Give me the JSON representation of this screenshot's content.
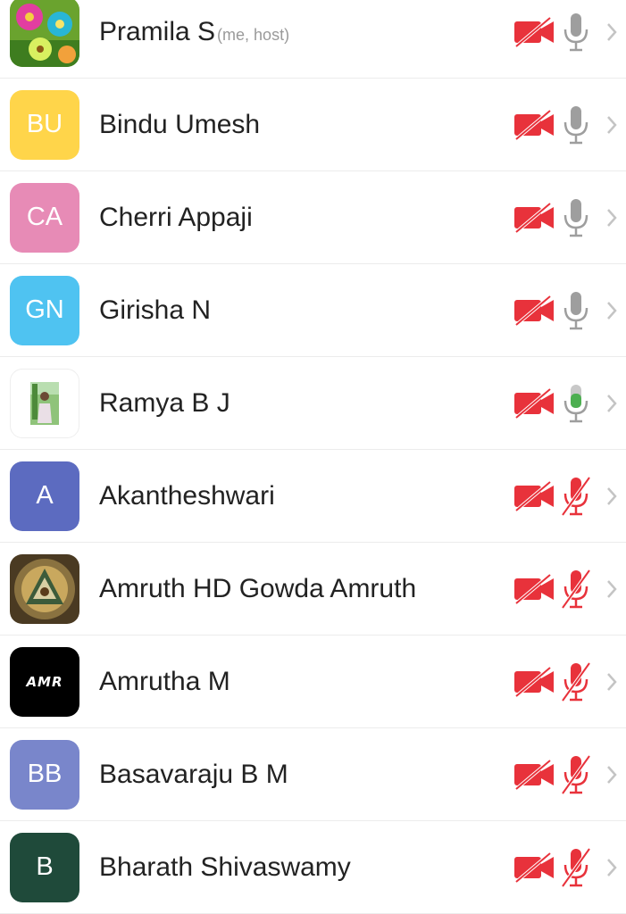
{
  "participants": [
    {
      "name": "Pramila S",
      "tag": "(me, host)",
      "avatar": {
        "type": "image",
        "icon": "flower-photo-avatar"
      },
      "video": "off",
      "audio": "on-idle"
    },
    {
      "name": "Bindu Umesh",
      "tag": "",
      "avatar": {
        "type": "initials",
        "initials": "BU",
        "color": "#FFD54A"
      },
      "video": "off",
      "audio": "on-idle"
    },
    {
      "name": "Cherri Appaji",
      "tag": "",
      "avatar": {
        "type": "initials",
        "initials": "CA",
        "color": "#E78BB6"
      },
      "video": "off",
      "audio": "on-idle"
    },
    {
      "name": "Girisha N",
      "tag": "",
      "avatar": {
        "type": "initials",
        "initials": "GN",
        "color": "#4FC3F1"
      },
      "video": "off",
      "audio": "on-idle"
    },
    {
      "name": "Ramya B J",
      "tag": "",
      "avatar": {
        "type": "image",
        "icon": "person-photo-avatar"
      },
      "video": "off",
      "audio": "speaking"
    },
    {
      "name": "Akantheshwari",
      "tag": "",
      "avatar": {
        "type": "initials",
        "initials": "A",
        "color": "#5C6BC0"
      },
      "video": "off",
      "audio": "muted"
    },
    {
      "name": "Amruth HD Gowda Amruth",
      "tag": "",
      "avatar": {
        "type": "image",
        "icon": "emblem-photo-avatar"
      },
      "video": "off",
      "audio": "muted"
    },
    {
      "name": "Amrutha M",
      "tag": "",
      "avatar": {
        "type": "image",
        "icon": "logo-avatar",
        "logo_text": "AMR"
      },
      "video": "off",
      "audio": "muted"
    },
    {
      "name": "Basavaraju B M",
      "tag": "",
      "avatar": {
        "type": "initials",
        "initials": "BB",
        "color": "#7986CB"
      },
      "video": "off",
      "audio": "muted"
    },
    {
      "name": "Bharath Shivaswamy",
      "tag": "",
      "avatar": {
        "type": "initials",
        "initials": "B",
        "color": "#1F4A3A"
      },
      "video": "off",
      "audio": "muted"
    }
  ],
  "colors": {
    "video_off": "#E8323B",
    "mic_idle": "#9E9E9E",
    "mic_speaking": "#4CAF50",
    "mic_muted": "#E8323B",
    "chevron": "#C4C4C4",
    "divider": "#ECECEC"
  },
  "icons": {
    "video": "video-off-icon",
    "mic": "microphone-icon",
    "mic_muted": "microphone-muted-icon",
    "chevron": "chevron-right-icon"
  }
}
